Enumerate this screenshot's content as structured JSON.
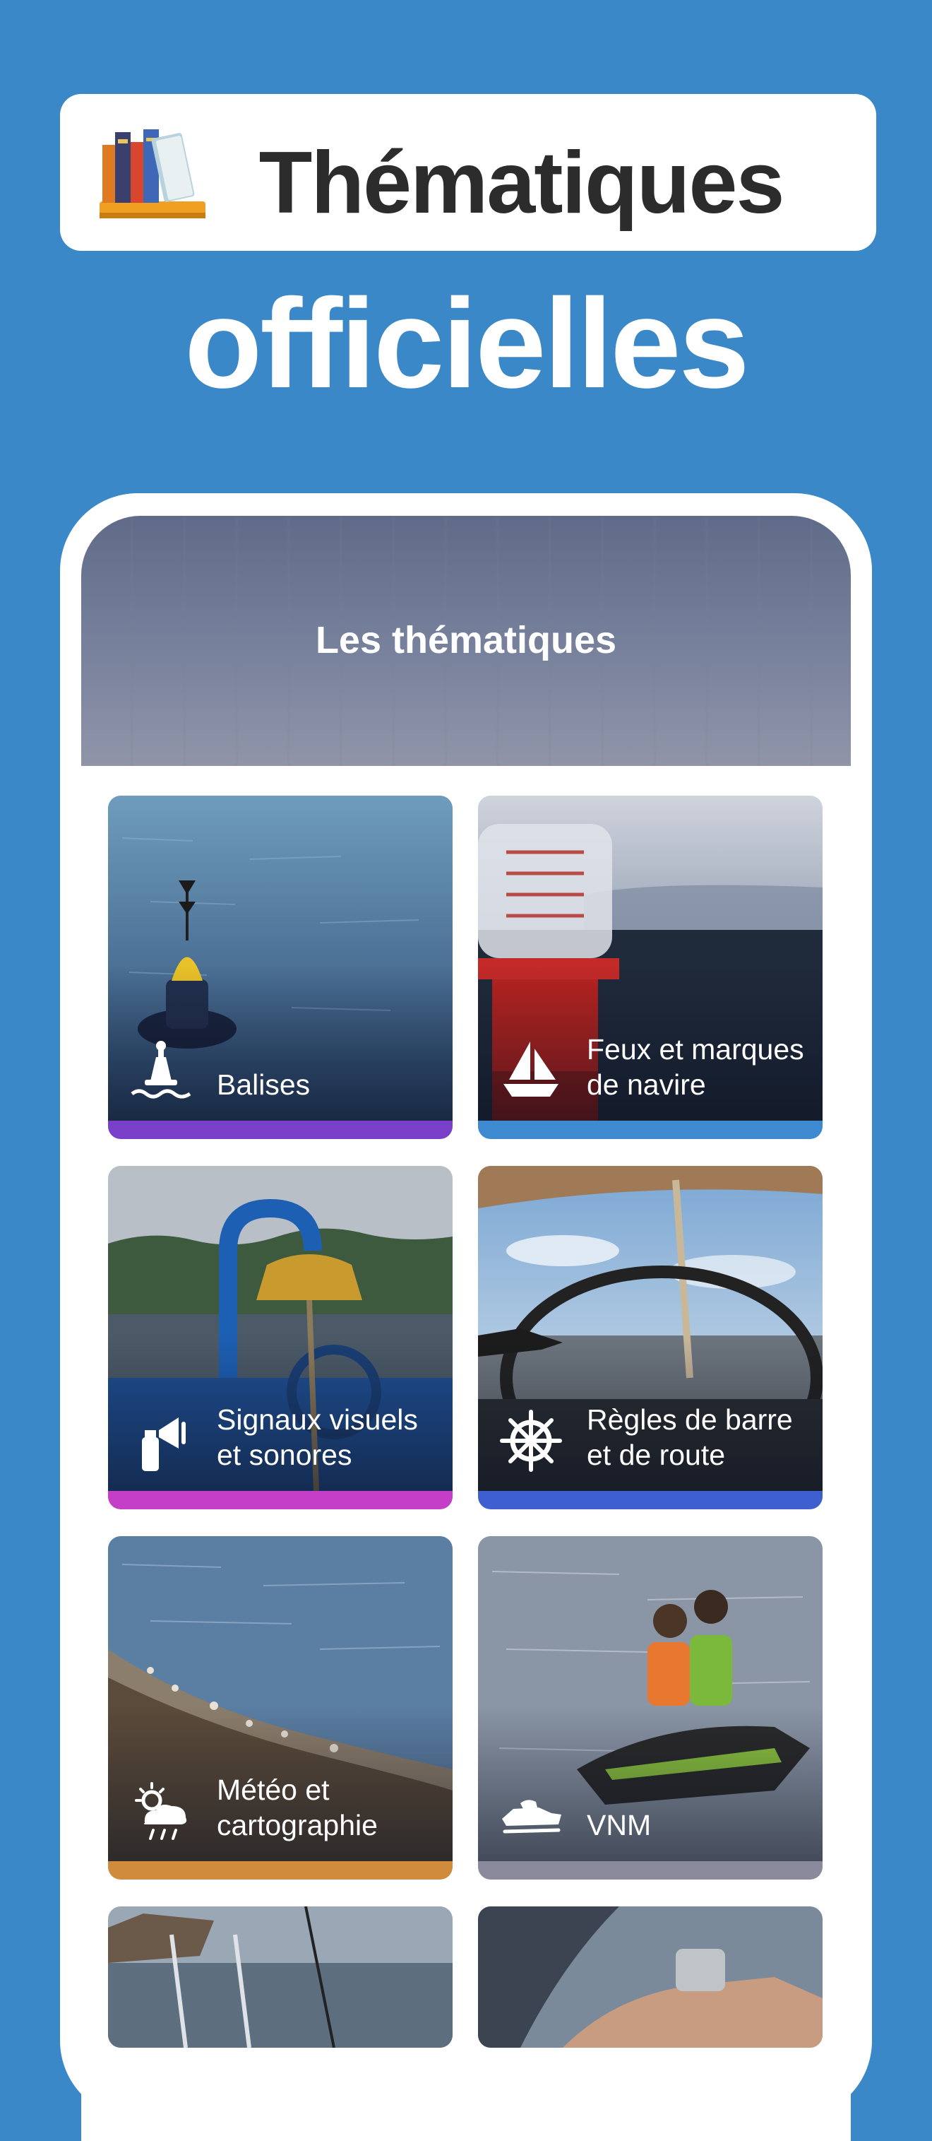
{
  "hero": {
    "title": "Thématiques",
    "subtitle": "officielles"
  },
  "app": {
    "header_title": "Les thématiques"
  },
  "themes": [
    {
      "label": "Balises",
      "icon": "buoy-icon",
      "accent": "#7a3fc8"
    },
    {
      "label": "Feux et marques\nde navire",
      "icon": "sailboat-icon",
      "accent": "#3d8ad0"
    },
    {
      "label": "Signaux visuels\net sonores",
      "icon": "signal-horn-icon",
      "accent": "#c53ec8"
    },
    {
      "label": "Règles de barre\net de route",
      "icon": "helm-wheel-icon",
      "accent": "#3d5fd0"
    },
    {
      "label": "Météo et\ncartographie",
      "icon": "weather-icon",
      "accent": "#d18b3c"
    },
    {
      "label": "VNM",
      "icon": "jet-ski-icon",
      "accent": "#8a8a9c"
    }
  ],
  "colors": {
    "background": "#3a88c7",
    "hero_title": "#2c2c2c"
  }
}
